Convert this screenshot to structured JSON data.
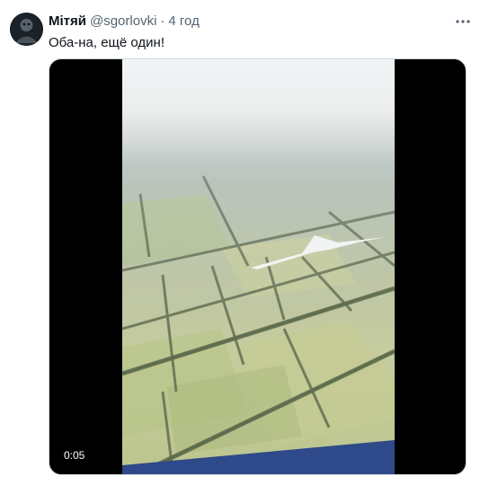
{
  "tweet": {
    "author_name": "Мітяй",
    "author_handle": "@sgorlovki",
    "separator": "·",
    "time": "4 год",
    "text": "Оба-на, ещё один!",
    "more_icon": "ellipsis-icon",
    "avatar_icon": "avatar-image"
  },
  "media": {
    "video_timer": "0:05"
  },
  "colors": {
    "text_primary": "#0f1419",
    "text_secondary": "#536471",
    "border": "#cfd9de"
  }
}
